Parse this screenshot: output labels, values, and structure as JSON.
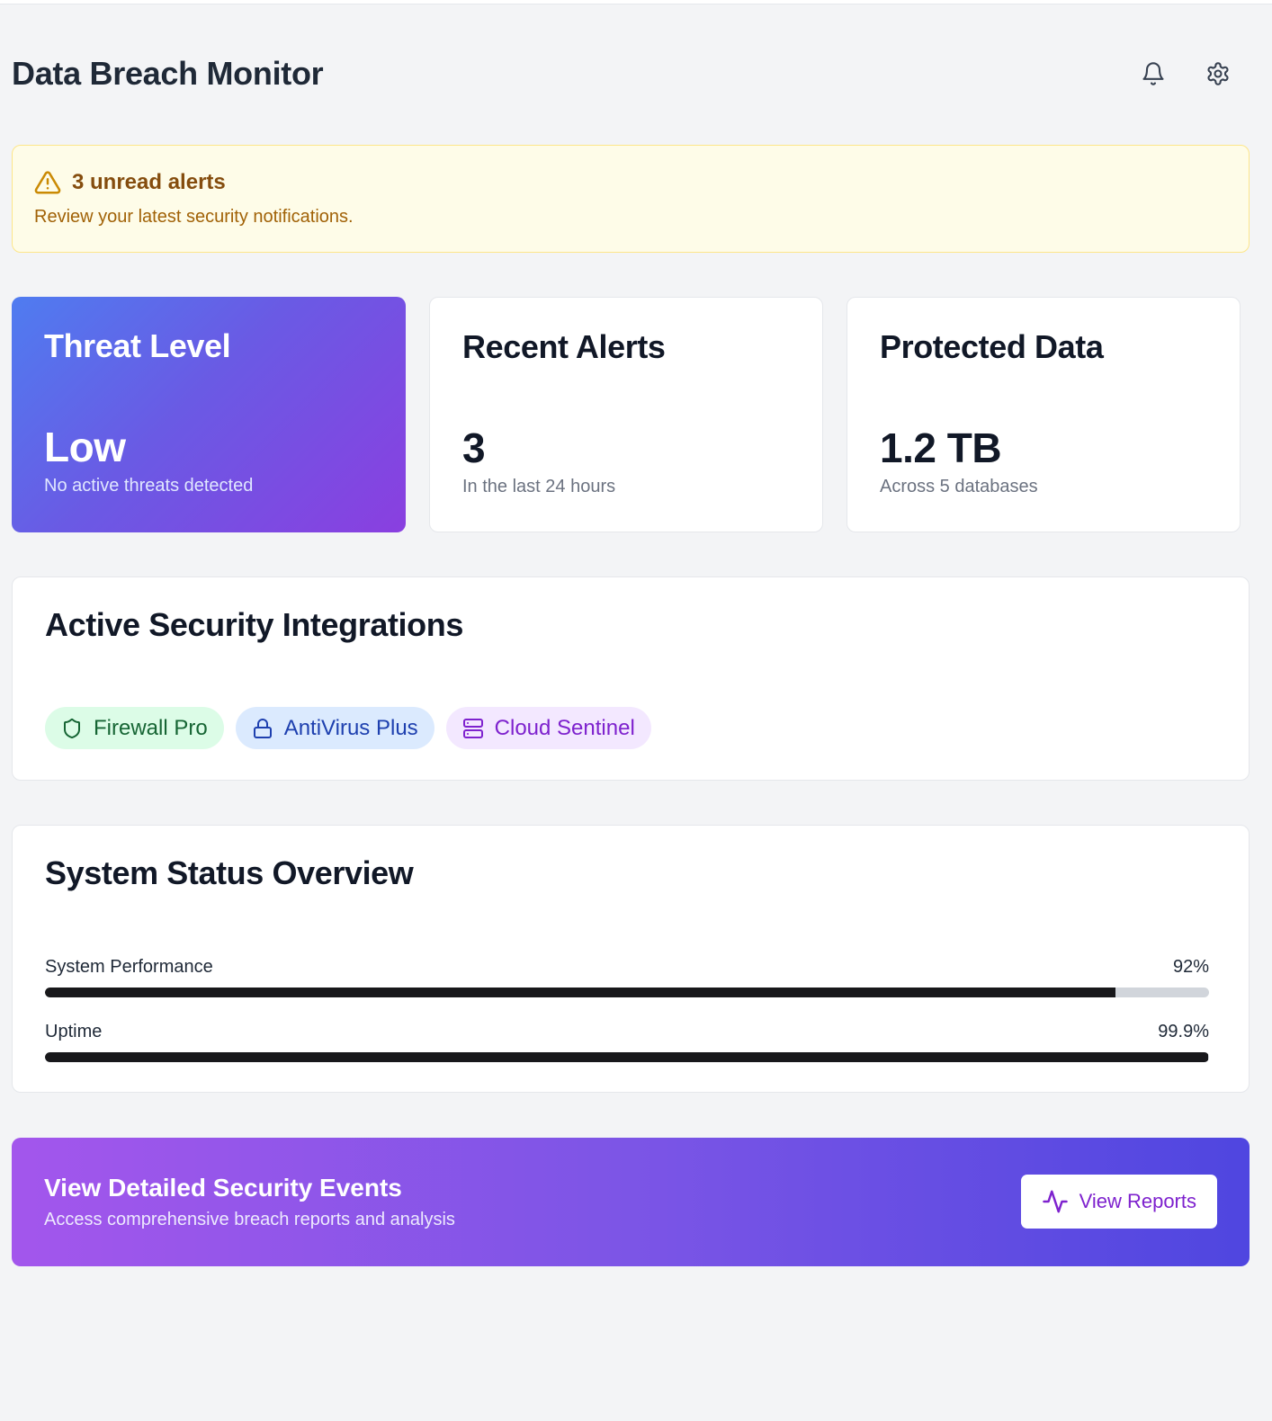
{
  "header": {
    "title": "Data Breach Monitor",
    "icons": [
      "bell-icon",
      "gear-icon"
    ]
  },
  "alert_banner": {
    "title": "3 unread alerts",
    "description": "Review your latest security notifications.",
    "icon": "warning-triangle-icon"
  },
  "stats": {
    "threat": {
      "title": "Threat Level",
      "value": "Low",
      "subtitle": "No active threats detected"
    },
    "alerts": {
      "title": "Recent Alerts",
      "value": "3",
      "subtitle": "In the last 24 hours"
    },
    "protected": {
      "title": "Protected Data",
      "value": "1.2 TB",
      "subtitle": "Across 5 databases"
    }
  },
  "integrations": {
    "title": "Active Security Integrations",
    "items": [
      {
        "label": "Firewall Pro",
        "icon": "shield-icon",
        "color": "#166534"
      },
      {
        "label": "AntiVirus Plus",
        "icon": "lock-icon",
        "color": "#1e40af"
      },
      {
        "label": "Cloud Sentinel",
        "icon": "server-icon",
        "color": "#7e22ce"
      }
    ]
  },
  "system_status": {
    "title": "System Status Overview",
    "metrics": [
      {
        "label": "System Performance",
        "value_text": "92%",
        "percent": 92
      },
      {
        "label": "Uptime",
        "value_text": "99.9%",
        "percent": 99.9
      }
    ]
  },
  "cta": {
    "title": "View Detailed Security Events",
    "subtitle": "Access comprehensive breach reports and analysis",
    "button_label": "View Reports",
    "button_icon": "activity-icon"
  },
  "colors": {
    "background": "#f3f4f6",
    "threat_gradient_start": "#4f7cf0",
    "threat_gradient_end": "#8a3fe0",
    "cta_gradient_start": "#a356ec",
    "cta_gradient_end": "#4f46e0",
    "progress_fill": "#18181b"
  }
}
